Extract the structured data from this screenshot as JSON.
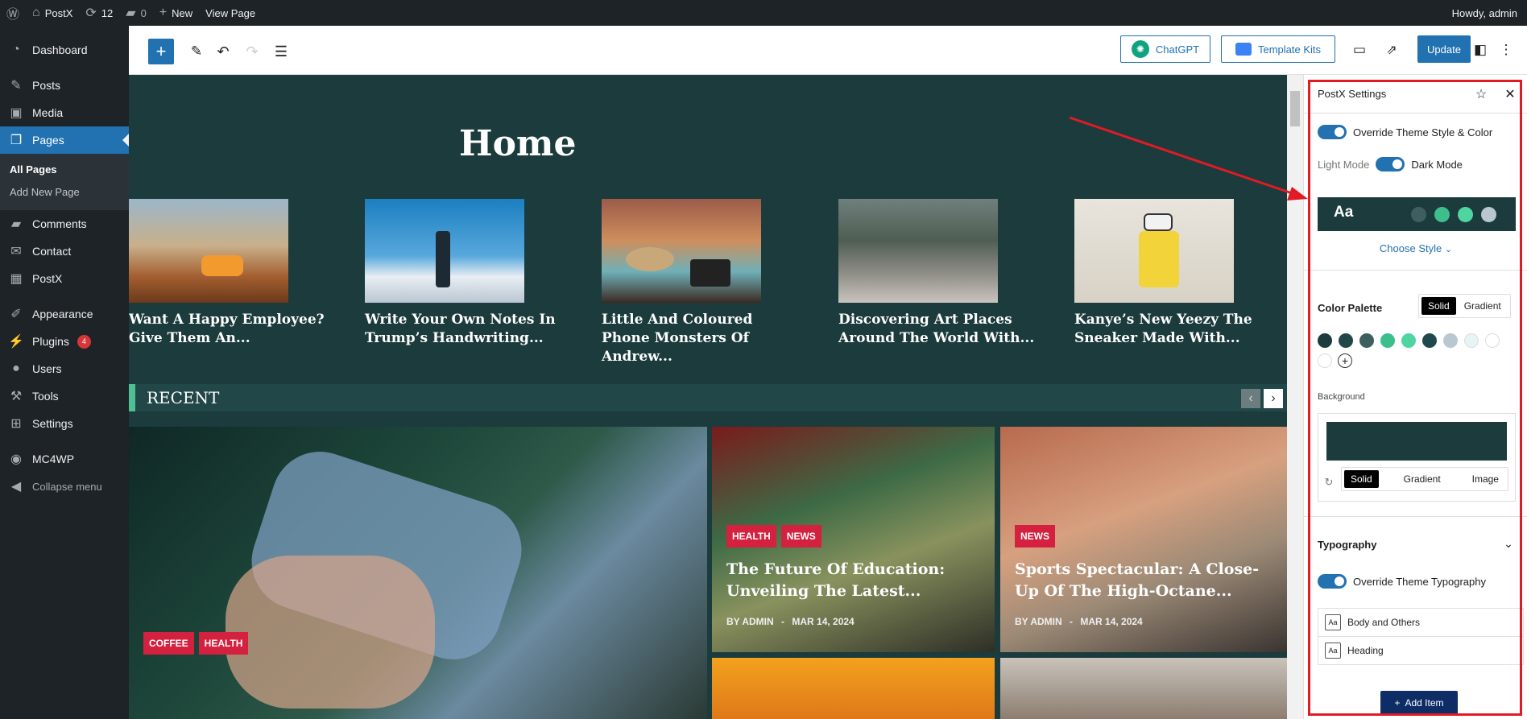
{
  "adminbar": {
    "site": "PostX",
    "updates": "12",
    "comments": "0",
    "new": "New",
    "view_page": "View Page",
    "greeting": "Howdy, admin"
  },
  "menu": {
    "dashboard": "Dashboard",
    "posts": "Posts",
    "media": "Media",
    "pages": "Pages",
    "all_pages": "All Pages",
    "add_new_page": "Add New Page",
    "comments": "Comments",
    "contact": "Contact",
    "postx": "PostX",
    "appearance": "Appearance",
    "plugins": "Plugins",
    "plugins_badge": "4",
    "users": "Users",
    "tools": "Tools",
    "settings": "Settings",
    "mc4wp": "MC4WP",
    "collapse": "Collapse menu"
  },
  "toolbar": {
    "chatgpt": "ChatGPT",
    "template_kits": "Template Kits",
    "update": "Update"
  },
  "canvas": {
    "home_title": "Home",
    "cards": [
      {
        "title": "Want A Happy Employee? Give Them An..."
      },
      {
        "title": "Write Your Own Notes In Trump’s Handwriting..."
      },
      {
        "title": "Little And Coloured Phone Monsters Of Andrew..."
      },
      {
        "title": "Discovering Art Places Around The World With..."
      },
      {
        "title": "Kanye’s New Yeezy The Sneaker Made With..."
      }
    ],
    "recent_title": "RECENT",
    "big_post": {
      "tags": [
        "COFFEE",
        "HEALTH"
      ]
    },
    "post1": {
      "tags": [
        "HEALTH",
        "NEWS"
      ],
      "title": "The Future Of Education: Unveiling The Latest...",
      "by": "BY",
      "author": "ADMIN",
      "sep": "-",
      "date": "MAR 14, 2024"
    },
    "post2": {
      "tags": [
        "NEWS"
      ],
      "title": "Sports Spectacular: A Close-Up Of The High-Octane...",
      "by": "BY",
      "author": "ADMIN",
      "sep": "-",
      "date": "MAR 14, 2024"
    }
  },
  "panel": {
    "title": "PostX Settings",
    "override_style": "Override Theme Style & Color",
    "light_mode": "Light Mode",
    "dark_mode": "Dark Mode",
    "preset_aa": "Aa",
    "choose_style": "Choose Style",
    "color_palette": "Color Palette",
    "palette_solid": "Solid",
    "palette_gradient": "Gradient",
    "background": "Background",
    "bg_solid": "Solid",
    "bg_gradient": "Gradient",
    "bg_image": "Image",
    "typography": "Typography",
    "override_typography": "Override Theme Typography",
    "typo_aa": "Aa",
    "body_and_others": "Body and Others",
    "heading": "Heading",
    "add_item": "Add Item"
  },
  "colors": {
    "accent": "#2271b1",
    "dark_bg": "#1b3b3d",
    "tag_red": "#d3213f",
    "highlight_red": "#e01b24",
    "palette": [
      "#1b3b3d",
      "#224748",
      "#3d5f5f",
      "#3dbf8c",
      "#4fd6a0",
      "#1e4a4f",
      "#b9c7d0",
      "#e6f4f4",
      "#ffffff",
      "#ffffff"
    ],
    "preset_dots": [
      "#3d5f5f",
      "#3dbf8c",
      "#4fd6a0",
      "#b9c7d0"
    ]
  }
}
